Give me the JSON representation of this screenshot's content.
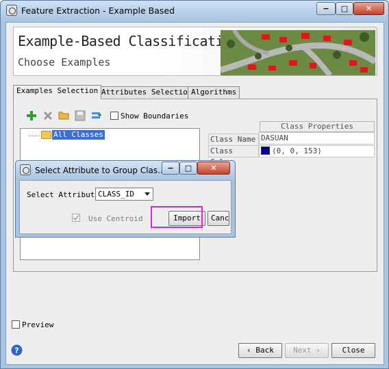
{
  "window": {
    "title": "Feature Extraction - Example Based",
    "controls": [
      "−",
      "□",
      "✕"
    ]
  },
  "header": {
    "title": "Example-Based Classification",
    "subtitle": "Choose Examples"
  },
  "tabs": [
    {
      "label": "Examples Selection",
      "active": true
    },
    {
      "label": "Attributes Selection",
      "active": false
    },
    {
      "label": "Algorithms",
      "active": false
    }
  ],
  "toolbar": {
    "icons": [
      "add-icon",
      "delete-icon",
      "open-folder-icon",
      "save-icon",
      "import-icon"
    ],
    "show_boundaries": {
      "label": "Show Boundaries",
      "checked": false
    }
  },
  "tree": {
    "items": [
      {
        "label": "All Classes",
        "selected": true
      }
    ]
  },
  "class_properties": {
    "header": "Class Properties",
    "rows": [
      {
        "key": "Class Name",
        "value": "DASUAN"
      },
      {
        "key": "Class Color",
        "value": "(0, 0, 153)",
        "color": "#000099"
      }
    ]
  },
  "dialog": {
    "title": "Select Attribute to Group Clas...",
    "controls": [
      "−",
      "□",
      "✕"
    ],
    "select_label": "Select Attribute",
    "select_value": "CLASS_ID",
    "use_centroid": {
      "label": "Use Centroid",
      "checked": true,
      "disabled": true
    },
    "import_label": "Import",
    "cancel_label": "Canc"
  },
  "footer": {
    "preview": {
      "label": "Preview",
      "checked": false
    },
    "back_label": "Back",
    "next_label": "Next",
    "close_label": "Close"
  },
  "accent_colors": {
    "selection": "#3b6fd6",
    "highlight": "#e31ee8"
  }
}
